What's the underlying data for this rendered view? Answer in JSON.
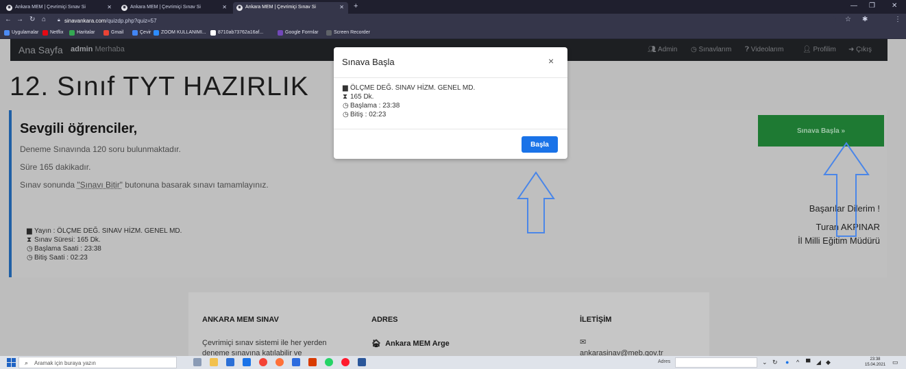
{
  "browser": {
    "tabs": [
      {
        "title": "Ankara MEM | Çevrimiçi Sınav Si",
        "active": false
      },
      {
        "title": "Ankara MEM | Çevrimiçi Sınav Si",
        "active": false
      },
      {
        "title": "Ankara MEM | Çevrimiçi Sınav Si",
        "active": true
      }
    ],
    "new_tab": "+",
    "url_host": "sinavankara.com",
    "url_path": "/quizdp.php?quiz=57",
    "bookmarks": [
      "Uygulamalar",
      "Netflix",
      "Haritalar",
      "Gmail",
      "Çevir",
      "ZOOM KULLANIMI...",
      "8710ab73762a16af...",
      "Google Formlar",
      "Screen Recorder"
    ]
  },
  "site_nav": {
    "brand": "Ana Sayfa",
    "user": "admin",
    "greeting": "Merhaba",
    "links": [
      "Admin",
      "Sınavlarım",
      "Videolarım",
      "Profilim",
      "Çıkış"
    ]
  },
  "page": {
    "title": "12. Sınıf TYT HAZIRLIK",
    "heading": "Sevgili öğrenciler,",
    "line1": "Deneme Sınavında 120 soru bulunmaktadır.",
    "line2": "Süre 165 dakikadır.",
    "line3_pre": "Sınav sonunda ",
    "line3_link": "\"Sınavı Bitir\"",
    "line3_post": " butonuna basarak sınavı tamamlayınız.",
    "start_button": "Sınava Başla »",
    "wish": "Başarılar Dilerim !",
    "signer_name": "Turan AKPINAR",
    "signer_title": "İl Milli Eğitim Müdürü",
    "meta": {
      "publisher": "Yayın : ÖLÇME DEĞ. SINAV HİZM. GENEL MD.",
      "duration": "Sınav Süresi: 165 Dk.",
      "start": "Başlama Saati : 23:38",
      "end": "Bitiş Saati : 02:23"
    }
  },
  "footer": {
    "col1_title": "ANKARA MEM SINAV",
    "col1_text1": "Çevrimiçi sınav sistemi ile her yerden",
    "col1_text2": "deneme sınavına katılabilir ve",
    "col2_title": "ADRES",
    "col2_text": "Ankara MEM Arge",
    "col3_title": "İLETİŞİM",
    "col3_text": "ankarasinav@meb.gov.tr"
  },
  "modal": {
    "title": "Sınava Başla",
    "close": "×",
    "publisher": "ÖLÇME DEĞ. SINAV HİZM. GENEL MD.",
    "duration": "165 Dk.",
    "start": "Başlama : 23:38",
    "end": "Bitiş : 02:23",
    "button": "Başla"
  },
  "taskbar": {
    "search_placeholder": "Aramak için buraya yazın",
    "address_label": "Adres",
    "time": "23:38",
    "date": "15.04.2021"
  },
  "colors": {
    "accent_green": "#1e7a33",
    "modal_button": "#1a73e8",
    "arrow_blue": "#4a86e8",
    "card_border": "#1f5fa5"
  }
}
